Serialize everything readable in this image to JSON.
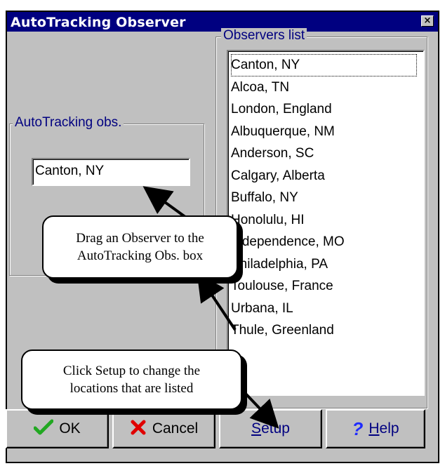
{
  "window": {
    "title": "AutoTracking Observer",
    "close_glyph": "×"
  },
  "autotracking": {
    "group_label": "AutoTracking obs.",
    "value": "Canton, NY"
  },
  "observers": {
    "group_label": "Observers list",
    "items": [
      "Canton, NY",
      "Alcoa, TN",
      "London, England",
      "Albuquerque, NM",
      "Anderson, SC",
      "Calgary, Alberta",
      "Buffalo, NY",
      "Honolulu, HI",
      "Independence, MO",
      "Philadelphia, PA",
      "Toulouse, France",
      "Urbana, IL",
      "Thule, Greenland"
    ],
    "selected_index": 0
  },
  "buttons": {
    "ok": "OK",
    "cancel": "Cancel",
    "setup": "Setup",
    "help": "Help"
  },
  "callouts": {
    "drag": [
      "Drag an Observer to the",
      "AutoTracking Obs. box"
    ],
    "setup": [
      "Click Setup to change the",
      "locations that are listed"
    ]
  },
  "colors": {
    "titlebar": "#000080",
    "face": "#c0c0c0",
    "label": "#000080",
    "ok_icon": "#22a822",
    "cancel_icon": "#e00000",
    "help_icon": "#1e2bff"
  },
  "icons": {
    "ok": "checkmark-icon",
    "cancel": "x-icon",
    "help": "question-mark-icon"
  }
}
